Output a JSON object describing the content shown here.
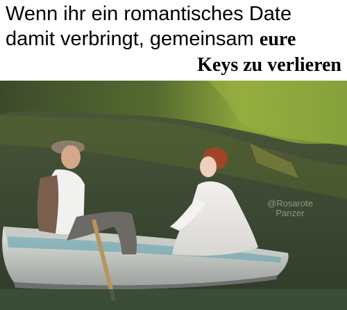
{
  "caption": {
    "line1": "Wenn ihr ein romantisches Date",
    "line2_regular": "damit verbringt, gemeinsam",
    "line2_bold": "eure",
    "line3": "Keys zu verlieren"
  },
  "watermark": {
    "line1": "@Rosarote",
    "line2": "Panzer"
  }
}
